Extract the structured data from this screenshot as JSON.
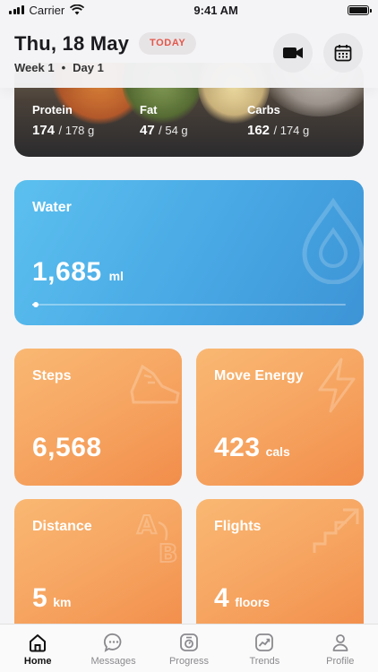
{
  "status_bar": {
    "carrier": "Carrier",
    "time": "9:41 AM"
  },
  "header": {
    "date": "Thu, 18 May",
    "today_badge": "TODAY",
    "week": "Week 1",
    "separator": "•",
    "day": "Day 1",
    "video_icon": "video-camera-icon",
    "calendar_icon": "calendar-icon"
  },
  "macros": [
    {
      "name": "Protein",
      "value": "174",
      "goal": "/ 178 g"
    },
    {
      "name": "Fat",
      "value": "47",
      "goal": "/ 54 g"
    },
    {
      "name": "Carbs",
      "value": "162",
      "goal": "/ 174 g"
    }
  ],
  "water": {
    "title": "Water",
    "value": "1,685",
    "unit": "ml",
    "progress": 0.01,
    "color": "#4aa9e4"
  },
  "steps": {
    "title": "Steps",
    "value": "6,568",
    "unit": ""
  },
  "move_energy": {
    "title": "Move Energy",
    "value": "423",
    "unit": "cals"
  },
  "distance": {
    "title": "Distance",
    "value": "5",
    "unit": "km"
  },
  "flights": {
    "title": "Flights",
    "value": "4",
    "unit": "floors"
  },
  "tabs": [
    {
      "label": "Home",
      "icon": "home-icon",
      "active": true
    },
    {
      "label": "Messages",
      "icon": "messages-icon",
      "active": false
    },
    {
      "label": "Progress",
      "icon": "progress-icon",
      "active": false
    },
    {
      "label": "Trends",
      "icon": "trends-icon",
      "active": false
    },
    {
      "label": "Profile",
      "icon": "profile-icon",
      "active": false
    }
  ],
  "colors": {
    "accent_orange": "#f6a561",
    "accent_blue": "#4aa9e4",
    "today_red": "#e4574a"
  }
}
